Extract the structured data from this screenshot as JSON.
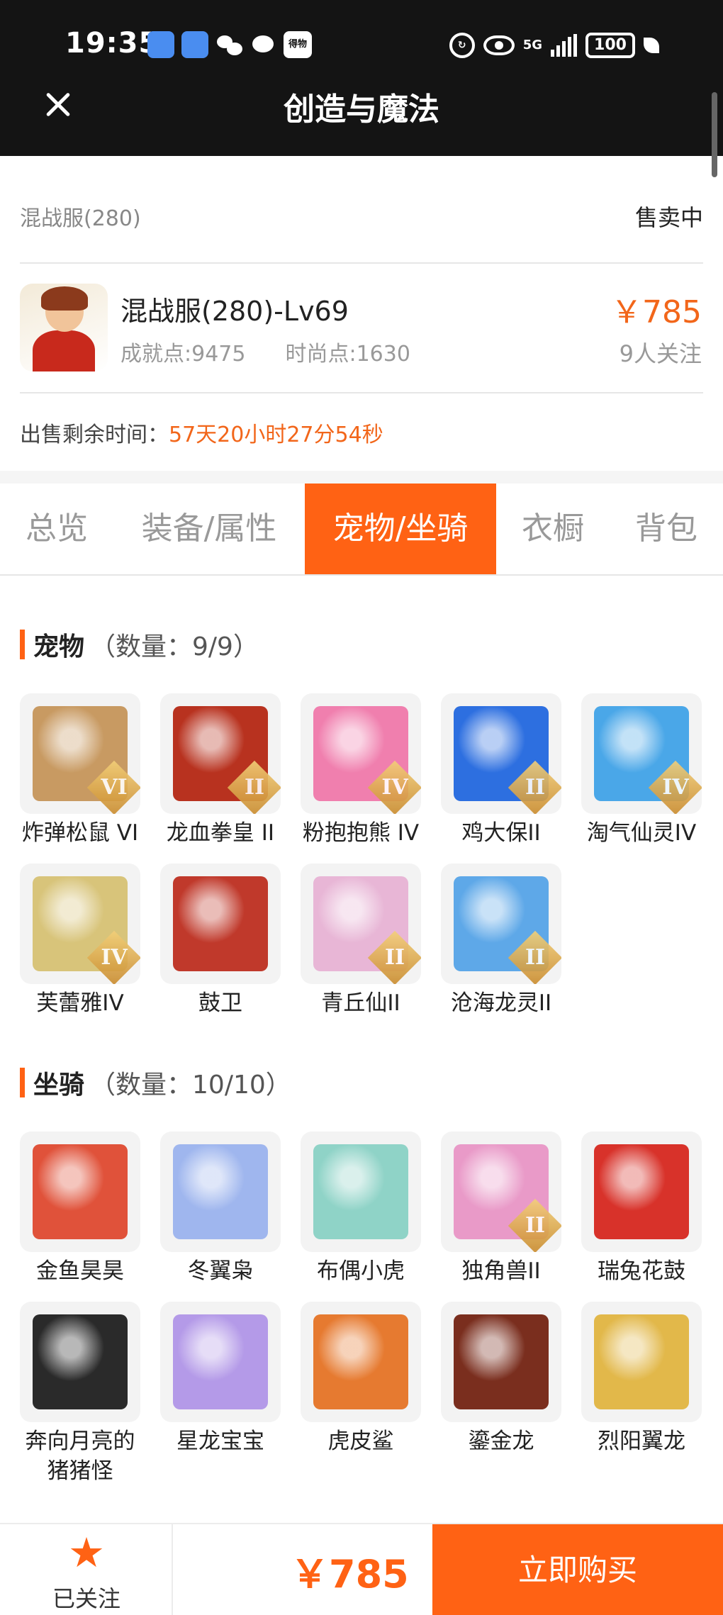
{
  "status_bar": {
    "time": "19:35",
    "notif_badge": "得物",
    "signal": "5G",
    "battery": "100"
  },
  "header": {
    "title": "创造与魔法"
  },
  "account": {
    "server": "混战服(280)",
    "sale_status": "售卖中",
    "name": "混战服(280)-Lv69",
    "achievement": "成就点:9475",
    "fashion": "时尚点:1630",
    "price": "￥785",
    "followers": "9人关注",
    "remaining_label": "出售剩余时间：",
    "remaining_value": "57天20小时27分54秒"
  },
  "tabs": [
    {
      "label": "总览"
    },
    {
      "label": "装备/属性"
    },
    {
      "label": "宠物/坐骑"
    },
    {
      "label": "衣橱"
    },
    {
      "label": "背包"
    }
  ],
  "pets": {
    "title": "宠物",
    "count": "（数量：9/9）",
    "items": [
      {
        "name": "炸弹松鼠 VI",
        "rank": "VI",
        "color": "#c89a62"
      },
      {
        "name": "龙血拳皇 II",
        "rank": "II",
        "color": "#b8321f"
      },
      {
        "name": "粉抱抱熊 IV",
        "rank": "IV",
        "color": "#f07fae"
      },
      {
        "name": "鸡大保II",
        "rank": "II",
        "color": "#2d6fe0"
      },
      {
        "name": "淘气仙灵IV",
        "rank": "IV",
        "color": "#4aa7e8"
      },
      {
        "name": "芙蕾雅IV",
        "rank": "IV",
        "color": "#d8c47a"
      },
      {
        "name": "鼓卫",
        "rank": "",
        "color": "#c0392b"
      },
      {
        "name": "青丘仙II",
        "rank": "II",
        "color": "#e8b6d6"
      },
      {
        "name": "沧海龙灵II",
        "rank": "II",
        "color": "#5ea8e8"
      }
    ]
  },
  "mounts": {
    "title": "坐骑",
    "count": "（数量：10/10）",
    "items": [
      {
        "name": "金鱼昊昊",
        "rank": "",
        "color": "#e0523a"
      },
      {
        "name": "冬翼枭",
        "rank": "",
        "color": "#9fb6ee"
      },
      {
        "name": "布偶小虎",
        "rank": "",
        "color": "#8fd3c7"
      },
      {
        "name": "独角兽II",
        "rank": "II",
        "color": "#e99ac8"
      },
      {
        "name": "瑞兔花鼓",
        "rank": "",
        "color": "#d8322a"
      },
      {
        "name": "奔向月亮的猪猪怪",
        "rank": "",
        "color": "#2a2a2a"
      },
      {
        "name": "星龙宝宝",
        "rank": "",
        "color": "#b49ae8"
      },
      {
        "name": "虎皮鲨",
        "rank": "",
        "color": "#e67a30"
      },
      {
        "name": "鎏金龙",
        "rank": "",
        "color": "#7a2e1e"
      },
      {
        "name": "烈阳翼龙",
        "rank": "",
        "color": "#e2b84a"
      }
    ]
  },
  "bottom": {
    "follow_label": "已关注",
    "price": "￥785",
    "buy_label": "立即购买"
  }
}
